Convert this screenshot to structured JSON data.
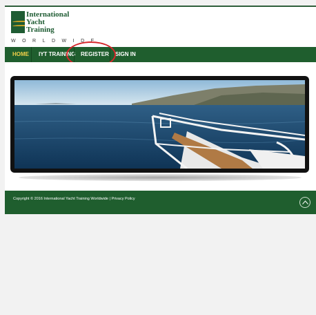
{
  "logo": {
    "line1": "International",
    "line2": "Yacht",
    "line3": "Training",
    "tagline": "WORLDWIDE"
  },
  "nav": {
    "items": [
      {
        "label": "HOME",
        "active": true
      },
      {
        "label": "IYT TRAINING",
        "active": false
      },
      {
        "label": "REGISTER",
        "active": false
      },
      {
        "label": "SIGN IN",
        "active": false
      }
    ]
  },
  "hero": {
    "icon": "yacht-bow-sea-photo"
  },
  "footer": {
    "copyright": "Copyright © 2016 International Yacht Training Worldwide | Privacy Policy",
    "back_to_top_icon": "chevron-up-circle-icon"
  },
  "colors": {
    "brand_green": "#1f5e2e",
    "active_nav": "#f2d04a",
    "annotation_red": "#d6262b"
  }
}
